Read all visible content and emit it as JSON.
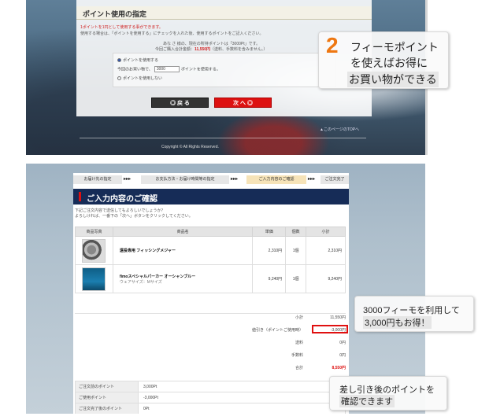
{
  "top_screen": {
    "heading": "ポイント使用の指定",
    "note_red": "1ポイントを1円として使用する事ができます。",
    "note_gray": "使用する場合は、「ポイントを使用する」にチェックを入れた後、使用するポイントをご記入ください。",
    "current_points": "あな さ 様の、現在の所持ポイントは「3000Pt」です。",
    "order_total_label": "今回ご購入合計金額：",
    "order_total_value": "11,550円",
    "order_total_note": "（送料、手数料を含みません。）",
    "option_use": "ポイントを使用する",
    "option_amount_prefix": "今回のお買い物で、",
    "option_amount_value": "3000",
    "option_amount_suffix": "ポイントを使用する。",
    "option_no_use": "ポイントを使用しない",
    "back_button": "◎ 戻 る",
    "next_button": "次 へ ◎",
    "page_top_link": "▲このページのTOPへ",
    "copyright": "Copyright © All Rights Reserved."
  },
  "callout_1": {
    "number": "2",
    "line1": "フィーモポイント",
    "line2": "を使えばお得に",
    "line3": "お買い物ができる"
  },
  "bottom_screen": {
    "steps": [
      "お届け先の指定",
      "お支払方法・お届け時間等の指定",
      "ご入力内容のご確認",
      "ご注文完了"
    ],
    "step_arrow": "▸▸▸",
    "title": "ご入力内容のご確認",
    "intro_line1": "下記ご注文内容で送信してもよろしいでしょうか？",
    "intro_line2": "よろしければ、一番下の「次へ」ボタンをクリックしてください。",
    "table_headers": [
      "商品写真",
      "商品名",
      "単価",
      "個数",
      "小計"
    ],
    "items": [
      {
        "name": "遠投専用 フィッシングメジャー",
        "sub": "",
        "price": "2,310円",
        "qty": "1個",
        "subtotal": "2,310円",
        "thumb": "reel"
      },
      {
        "name": "fimoスペシャルパーカー オーシャンブルー",
        "sub": "ウェアサイズ：Mサイズ",
        "price": "9,240円",
        "qty": "1個",
        "subtotal": "9,240円",
        "thumb": "parka"
      }
    ],
    "summary": [
      {
        "label": "小計",
        "value": "11,550円"
      },
      {
        "label": "値引き（ポイントご使用時）",
        "value": "-3,000円"
      },
      {
        "label": "送料",
        "value": "0円"
      },
      {
        "label": "手数料",
        "value": "0円"
      },
      {
        "label": "合計",
        "value": "8,550円"
      }
    ],
    "points": [
      {
        "label": "ご注文前のポイント",
        "value": "3,000Pt"
      },
      {
        "label": "ご使用ポイント",
        "value": "-3,000Pt"
      },
      {
        "label": "ご注文完了後のポイント",
        "value": "0Pt"
      }
    ]
  },
  "callout_2": {
    "line1": "3000フィーモを利用して",
    "line2": "3,000円もお得！"
  },
  "callout_3": {
    "line1": "差し引き後のポイントを",
    "line2": "確認できます"
  },
  "colors": {
    "accent_red": "#dd1111",
    "header_navy": "#162c57",
    "callout_number": "#ee7711"
  }
}
